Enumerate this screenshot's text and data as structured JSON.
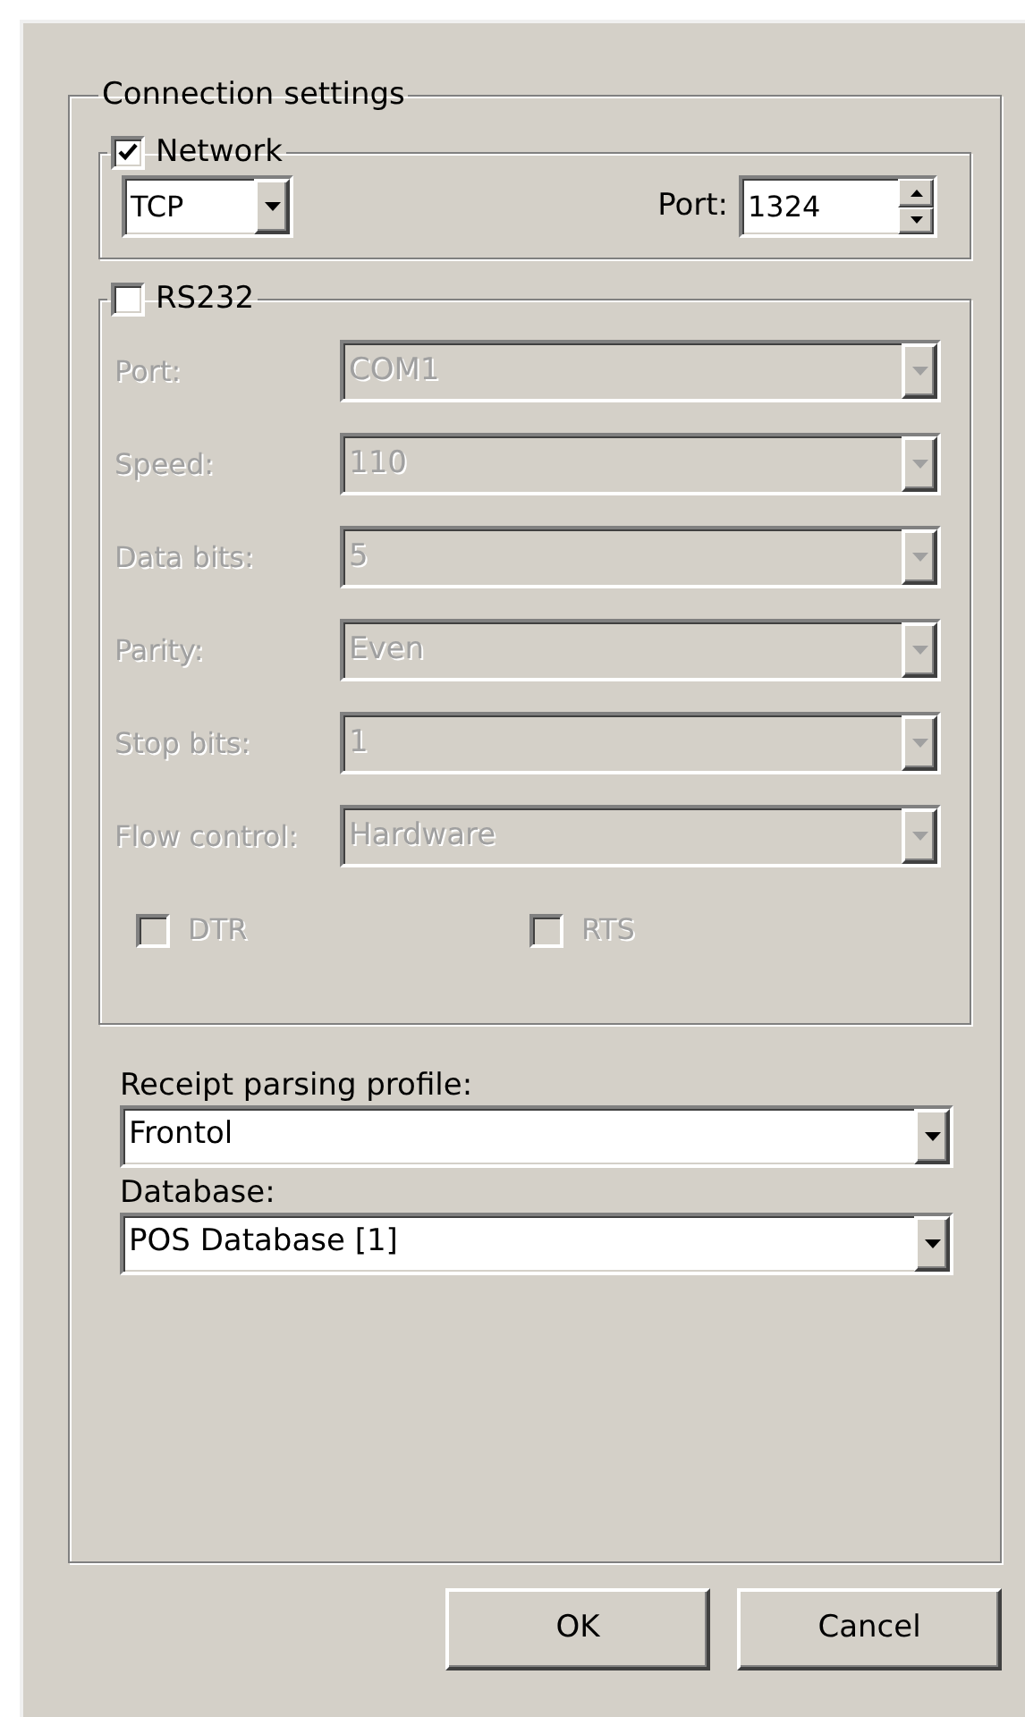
{
  "group_title": "Connection settings",
  "network": {
    "label": "Network",
    "checked": true,
    "protocol": "TCP",
    "port_label": "Port:",
    "port": "1324"
  },
  "rs232": {
    "label": "RS232",
    "checked": false,
    "fields": [
      {
        "label": "Port:",
        "value": "COM1",
        "disabled": true
      },
      {
        "label": "Speed:",
        "value": "110",
        "disabled": true
      },
      {
        "label": "Data bits:",
        "value": "5",
        "disabled": true
      },
      {
        "label": "Parity:",
        "value": "Even",
        "disabled": true
      },
      {
        "label": "Stop bits:",
        "value": "1",
        "disabled": true
      },
      {
        "label": "Flow control:",
        "value": "Hardware",
        "disabled": true
      }
    ],
    "flags": [
      {
        "label": "DTR",
        "checked": false,
        "disabled": true
      },
      {
        "label": "RTS",
        "checked": false,
        "disabled": true
      }
    ]
  },
  "selects": [
    {
      "label": "Receipt parsing profile:",
      "value": "Frontol"
    },
    {
      "label": "Database:",
      "value": "POS Database [1]"
    }
  ],
  "buttons": [
    "OK",
    "Cancel"
  ]
}
